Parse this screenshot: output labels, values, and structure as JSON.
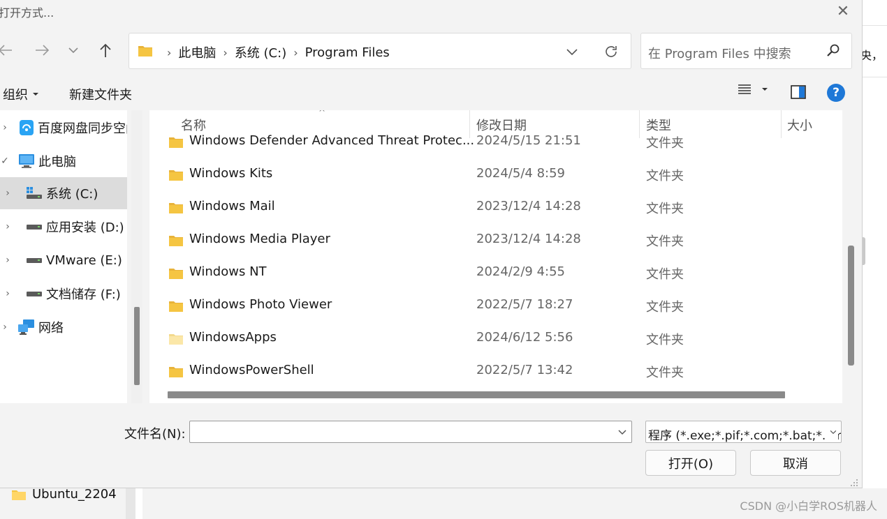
{
  "dialog": {
    "title": "打开方式...",
    "close_glyph": "✕"
  },
  "address": {
    "breadcrumbs": [
      "此电脑",
      "系统 (C:)",
      "Program Files"
    ],
    "separator": "›"
  },
  "search": {
    "placeholder": "在 Program Files 中搜索"
  },
  "toolbar": {
    "organize_label": "组织",
    "new_folder_label": "新建文件夹",
    "help_glyph": "?"
  },
  "nav_pane": {
    "items": [
      {
        "label": "百度网盘同步空间",
        "icon": "baidu-netdisk-icon",
        "expanded": false
      },
      {
        "label": "此电脑",
        "icon": "computer-icon",
        "expanded": true
      },
      {
        "label": "系统 (C:)",
        "icon": "drive-icon",
        "selected": true
      },
      {
        "label": "应用安装 (D:)",
        "icon": "drive-icon"
      },
      {
        "label": "VMware (E:)",
        "icon": "drive-icon"
      },
      {
        "label": "文档储存 (F:)",
        "icon": "drive-icon"
      },
      {
        "label": "网络",
        "icon": "network-icon"
      }
    ]
  },
  "file_list": {
    "columns": [
      "名称",
      "修改日期",
      "类型",
      "大小"
    ],
    "rows": [
      {
        "name": "Windows Defender Advanced Threat Protec...",
        "date": "2024/5/15 21:51",
        "type": "文件夹"
      },
      {
        "name": "Windows Kits",
        "date": "2024/5/4 8:59",
        "type": "文件夹"
      },
      {
        "name": "Windows Mail",
        "date": "2023/12/4 14:28",
        "type": "文件夹"
      },
      {
        "name": "Windows Media Player",
        "date": "2023/12/4 14:28",
        "type": "文件夹"
      },
      {
        "name": "Windows NT",
        "date": "2024/2/9 4:55",
        "type": "文件夹"
      },
      {
        "name": "Windows Photo Viewer",
        "date": "2022/5/7 18:27",
        "type": "文件夹"
      },
      {
        "name": "WindowsApps",
        "date": "2024/6/12 5:56",
        "type": "文件夹"
      },
      {
        "name": "WindowsPowerShell",
        "date": "2022/5/7 13:42",
        "type": "文件夹"
      }
    ]
  },
  "footer": {
    "filename_label": "文件名(N):",
    "filename_value": "",
    "filter_value": "程序 (*.exe;*.pif;*.com;*.bat;*.cmd)",
    "open_label": "打开(O)",
    "cancel_label": "取消"
  },
  "background": {
    "partial_text": "央，",
    "folder_label": "Ubuntu_2204",
    "watermark": "CSDN @小白学ROS机器人"
  },
  "colors": {
    "folder": "#f5c542",
    "folder_light": "#fbe7a8",
    "help_blue": "#1e78d7",
    "scroll_thumb": "#8a8a8a"
  }
}
